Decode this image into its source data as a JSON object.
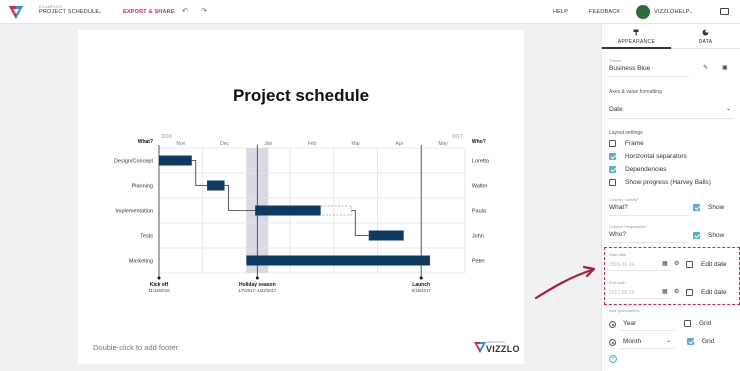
{
  "topbar": {
    "crumb_small": "EXAMPLES",
    "crumb_main": "PROJECT SCHEDULE",
    "export": "EXPORT & SHARE",
    "help": "HELP",
    "feedback": "FEEDBACK",
    "user": "VIZZLOHELP"
  },
  "chart_data": {
    "type": "gantt",
    "title": "Project schedule",
    "year_labels": [
      "2016",
      "2017"
    ],
    "months": [
      "Nov",
      "Dec",
      "Jan",
      "Feb",
      "Mar",
      "Apr",
      "May"
    ],
    "what_header": "What?",
    "who_header": "Who?",
    "rows": [
      {
        "activity": "Design/Concept",
        "who": "Loretta",
        "start": 0.0,
        "end": 0.75
      },
      {
        "activity": "Planning",
        "who": "Walter",
        "start": 1.1,
        "end": 1.5
      },
      {
        "activity": "Implementation",
        "who": "Paula",
        "start": 2.2,
        "end": 3.7,
        "extension_end": 4.4
      },
      {
        "activity": "Tests",
        "who": "John",
        "start": 4.8,
        "end": 5.6
      },
      {
        "activity": "Marketing",
        "who": "Peter",
        "start": 2.0,
        "end": 6.2
      }
    ],
    "dependencies": [
      [
        0,
        1
      ],
      [
        1,
        2
      ],
      [
        2,
        3
      ]
    ],
    "holiday": {
      "start": 2.0,
      "end": 2.5
    },
    "milestones": [
      {
        "label": "Kick off",
        "date": "11/16/2016",
        "at": 0.0
      },
      {
        "label": "Holiday season",
        "date": "1/7/2017–1/22/2017",
        "at": 2.25
      },
      {
        "label": "Launch",
        "date": "5/16/2017",
        "at": 6.0
      }
    ]
  },
  "canvas": {
    "footer_hint": "Double-click to add footer",
    "brand_small": "CREATED WITH",
    "brand": "VIZZLO"
  },
  "panel": {
    "tab_appearance": "APPEARANCE",
    "tab_data": "DATA",
    "theme_label": "Theme",
    "theme_value": "Business Blue",
    "axes_title": "Axes & value formatting",
    "axes_value": "Date",
    "layout_title": "Layout settings",
    "options": [
      {
        "label": "Frame",
        "checked": false
      },
      {
        "label": "Horizontal separators",
        "checked": true
      },
      {
        "label": "Dependencies",
        "checked": true
      },
      {
        "label": "Show progress (Harvey Balls)",
        "checked": false
      }
    ],
    "col_activity_label": "Column \"activity\"",
    "col_activity_value": "What?",
    "col_responsible_label": "Column \"responsible\"",
    "col_responsible_value": "Who?",
    "show_label": "Show",
    "start_date_label": "Start date",
    "start_date_value": "2016-11-16",
    "end_date_label": "End date",
    "end_date_value": "2017-05-16",
    "edit_date_label": "Edit date",
    "axis_gran_label": "Axis granularities",
    "gran_year": "Year",
    "gran_month": "Month",
    "grid_label": "Grid"
  },
  "colors": {
    "bar": "#0c3a63",
    "accent": "#d7264b",
    "check": "#5bb0c8",
    "holiday": "#d8d9e3"
  }
}
